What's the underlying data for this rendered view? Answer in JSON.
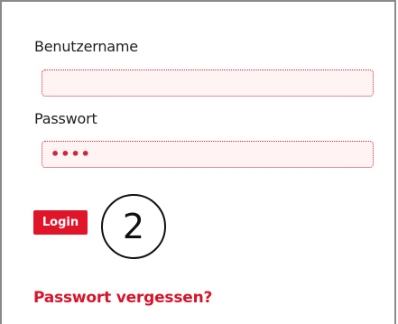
{
  "form": {
    "username_label": "Benutzername",
    "username_value": "",
    "password_label": "Passwort",
    "password_value_masked": "••••",
    "login_label": "Login",
    "forgot_password_label": "Passwort vergessen?"
  },
  "annotation": {
    "step_number": "2"
  },
  "colors": {
    "accent": "#e0152a",
    "input_background": "#fff3f3",
    "input_border": "#d2253b",
    "panel_border": "#8a8a8a"
  }
}
